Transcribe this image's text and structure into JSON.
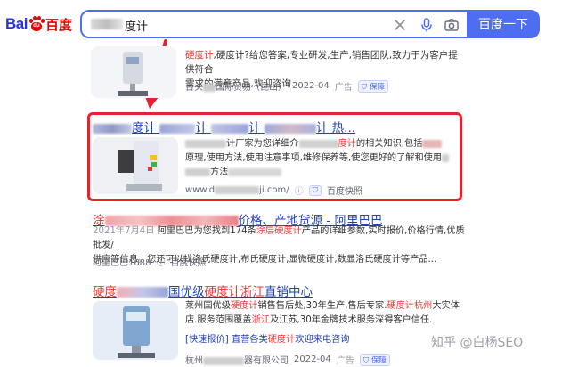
{
  "header": {
    "logo_bai": "Bai",
    "logo_du": "du",
    "logo_cn": "百度",
    "search_text": "度计",
    "search_button": "百度一下"
  },
  "results": [
    {
      "title_prefix": "硬度计",
      "desc_line1_red": "硬度计",
      "desc_line1": ",硬度计?给您答案,专业研发,生产,销售团队,致力于为客户提供符合",
      "desc_line2": "需求的满意产品,欢迎咨询.",
      "source_prefix": "台头",
      "source_suffix": "国际贸易（昆山）",
      "date": "2022-04",
      "ad": "广告",
      "baozhang": "保障"
    },
    {
      "title_parts": [
        "度计",
        "计",
        "计",
        "计 热..."
      ],
      "desc_part1": "计厂家为您详细介",
      "desc_red1": "度计",
      "desc_part2": "的相关知识,包括",
      "desc_line2": "原理,使用方法,使用注意事项,维修保养等,使您更好的了解和使用",
      "desc_line3": "方法",
      "url_prefix": "www.d",
      "url_suffix": "ji.com/",
      "snapshot": "百度快照"
    },
    {
      "title_prefix": "涂",
      "title_suffix": "价格、产地货源 - 阿里巴巴",
      "date_line": "2021年7月4日",
      "desc_line1a": "阿里巴巴为您找到174条",
      "desc_red1": "涂层硬度计",
      "desc_line1b": "产品的详细参数,实时报价,价格行情,优质批发/",
      "desc_line2": "供应等信息。您还可以找洛氏硬度计,布氏硬度计,显微硬度计,数显洛氏硬度计等产品...",
      "source": "阿里巴巴1688",
      "snapshot": "百度快照"
    },
    {
      "title_prefix": "硬度",
      "title_mid": "国优级",
      "title_red": "硬度计浙江",
      "title_suffix": "直销中心",
      "desc_l1a": "莱州国优级",
      "desc_l1r": "硬度计",
      "desc_l1b": "销售售后处,30年生产,售后专家.",
      "desc_l1r2": "硬度计杭州",
      "desc_l1c": "大实体",
      "desc_l2a": "店.服务范围覆盖",
      "desc_l2r": "浙江",
      "desc_l2b": "及江苏,30年金牌技术服务深得客户信任.",
      "quick_label": "[快速报价]",
      "quick_link": "直营各类",
      "quick_red": "硬度计",
      "quick_link2": "欢迎来电咨询",
      "source_prefix": "杭州",
      "source_suffix": "器有限公司",
      "date": "2022-04",
      "ad": "广告",
      "baozhang": "保障"
    }
  ],
  "watermark": "知乎 @白杨SEO",
  "colors": {
    "brand_blue": "#4e6ef2",
    "link_blue": "#2440b3",
    "highlight_red": "#f73131",
    "annotation_red": "#e8202f"
  }
}
